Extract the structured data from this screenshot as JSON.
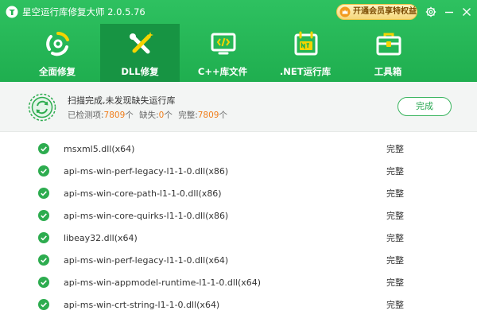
{
  "app": {
    "title": "星空运行库修复大师 2.0.5.76",
    "vip_button": "开通会员享特权益",
    "icons": [
      "app-logo-icon",
      "crown-icon",
      "gear-icon",
      "minimize-icon",
      "close-icon"
    ]
  },
  "colors": {
    "header_green": "#21b152",
    "active_tab": "#179443",
    "check_green": "#2dac4f",
    "count_orange": "#f07d1a"
  },
  "nav": {
    "tabs": [
      {
        "label": "全面修复",
        "icon": "refresh-cycle-icon",
        "active": false
      },
      {
        "label": "DLL修复",
        "icon": "dll-wrench-icon",
        "active": true
      },
      {
        "label": "C++库文件",
        "icon": "cpp-code-icon",
        "active": false
      },
      {
        "label": ".NET运行库",
        "icon": "dotnet-calendar-icon",
        "active": false
      },
      {
        "label": "工具箱",
        "icon": "toolbox-icon",
        "active": false
      }
    ]
  },
  "status": {
    "title": "扫描完成,未发现缺失运行库",
    "detected_label": "已检测项:",
    "detected_value": "7809",
    "detected_unit": "个",
    "missing_label": "缺失:",
    "missing_value": "0",
    "missing_unit": "个",
    "complete_label": "完整:",
    "complete_value": "7809",
    "complete_unit": "个",
    "done_button": "完成"
  },
  "list": {
    "rows": [
      {
        "name": "msxml5.dll(x64)",
        "status": "完整"
      },
      {
        "name": "api-ms-win-perf-legacy-l1-1-0.dll(x86)",
        "status": "完整"
      },
      {
        "name": "api-ms-win-core-path-l1-1-0.dll(x86)",
        "status": "完整"
      },
      {
        "name": "api-ms-win-core-quirks-l1-1-0.dll(x86)",
        "status": "完整"
      },
      {
        "name": "libeay32.dll(x64)",
        "status": "完整"
      },
      {
        "name": "api-ms-win-perf-legacy-l1-1-0.dll(x64)",
        "status": "完整"
      },
      {
        "name": "api-ms-win-appmodel-runtime-l1-1-0.dll(x64)",
        "status": "完整"
      },
      {
        "name": "api-ms-win-crt-string-l1-1-0.dll(x64)",
        "status": "完整"
      }
    ]
  }
}
